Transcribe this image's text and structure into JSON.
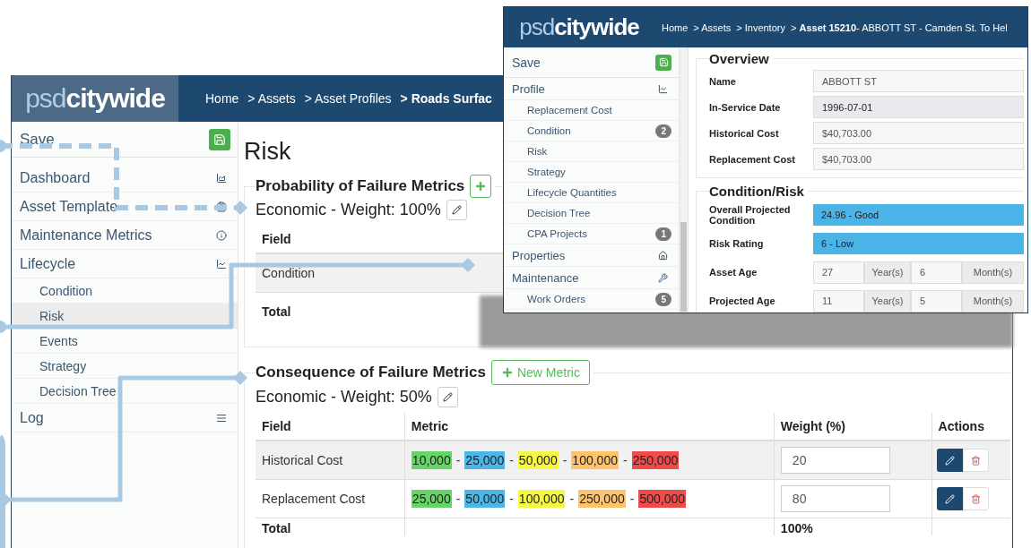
{
  "back_window": {
    "logo": {
      "light": "psd",
      "bold": "citywide"
    },
    "breadcrumb": [
      {
        "text": "Home",
        "bold": false
      },
      {
        "text": "> Assets",
        "bold": false
      },
      {
        "text": "> Asset Profiles",
        "bold": false
      },
      {
        "text": "> Roads Surfac",
        "bold": true
      }
    ],
    "sidebar": {
      "save": "Save",
      "items": [
        {
          "label": "Dashboard"
        },
        {
          "label": "Asset Template"
        },
        {
          "label": "Maintenance Metrics"
        },
        {
          "label": "Lifecycle",
          "children": [
            {
              "label": "Condition",
              "selected": false
            },
            {
              "label": "Risk",
              "selected": true
            },
            {
              "label": "Events",
              "selected": false
            },
            {
              "label": "Strategy",
              "selected": false
            },
            {
              "label": "Decision Tree",
              "selected": false
            }
          ]
        },
        {
          "label": "Log"
        }
      ]
    },
    "page_title": "Risk",
    "sections": [
      {
        "title": "Probability of Failure Metrics",
        "weight": "Economic - Weight: 100%",
        "columns": [
          "Field"
        ],
        "rows": [
          {
            "field": "Condition"
          }
        ],
        "total": {
          "label": "Total"
        }
      },
      {
        "title": "Consequence of Failure Metrics",
        "button": "New Metric",
        "weight": "Economic - Weight: 50%",
        "columns": [
          "Field",
          "Metric",
          "Weight (%)",
          "Actions"
        ],
        "rows": [
          {
            "field": "Historical Cost",
            "metric": [
              {
                "kind": "tag",
                "text": "10,000",
                "color": "#66d466"
              },
              {
                "kind": "dash",
                "text": "-"
              },
              {
                "kind": "tag",
                "text": "25,000",
                "color": "#4db6e8"
              },
              {
                "kind": "dash",
                "text": "-"
              },
              {
                "kind": "tag",
                "text": "50,000",
                "color": "#f6f742"
              },
              {
                "kind": "dash",
                "text": "-"
              },
              {
                "kind": "tag",
                "text": "100,000",
                "color": "#ffc36b"
              },
              {
                "kind": "dash",
                "text": "-"
              },
              {
                "kind": "tag",
                "text": "250,000",
                "color": "#f04a4a"
              }
            ],
            "weight": "20"
          },
          {
            "field": "Replacement Cost",
            "metric": [
              {
                "kind": "tag",
                "text": "25,000",
                "color": "#66d466"
              },
              {
                "kind": "dash",
                "text": "-"
              },
              {
                "kind": "tag",
                "text": "50,000",
                "color": "#4db6e8"
              },
              {
                "kind": "dash",
                "text": "-"
              },
              {
                "kind": "tag",
                "text": "100,000",
                "color": "#f6f742"
              },
              {
                "kind": "dash",
                "text": "-"
              },
              {
                "kind": "tag",
                "text": "250,000",
                "color": "#ffc36b"
              },
              {
                "kind": "dash",
                "text": "-"
              },
              {
                "kind": "tag",
                "text": "500,000",
                "color": "#f04a4a"
              }
            ],
            "weight": "80"
          }
        ],
        "total": {
          "label": "Total",
          "weight": "100%"
        }
      }
    ]
  },
  "front_window": {
    "logo": {
      "light": "psd",
      "bold": "citywide"
    },
    "breadcrumb": [
      {
        "text": "Home"
      },
      {
        "text": "> Assets"
      },
      {
        "text": "> Inventory"
      },
      {
        "text": "> **Asset 15210**- ABBOTT ST - Camden St. To Hel"
      }
    ],
    "sidebar": {
      "save": "Save",
      "items": [
        {
          "label": "Profile",
          "children": [
            {
              "label": "Replacement Cost"
            },
            {
              "label": "Condition",
              "badge": "2"
            },
            {
              "label": "Risk"
            },
            {
              "label": "Strategy"
            },
            {
              "label": "Lifecycle Quantities"
            },
            {
              "label": "Decision Tree"
            },
            {
              "label": "CPA Projects",
              "badge": "1"
            }
          ]
        },
        {
          "label": "Properties"
        },
        {
          "label": "Maintenance",
          "children": [
            {
              "label": "Work Orders",
              "badge": "5"
            }
          ]
        }
      ]
    },
    "overview": {
      "title": "Overview",
      "fields": [
        {
          "label": "Name",
          "value": "ABBOTT ST",
          "disabled": false
        },
        {
          "label": "In-Service Date",
          "value": "1996-07-01",
          "disabled": true
        },
        {
          "label": "Historical Cost",
          "value": "$40,703.00",
          "disabled": false
        },
        {
          "label": "Replacement Cost",
          "value": "$40,703.00",
          "disabled": false
        }
      ]
    },
    "condition_risk": {
      "title": "Condition/Risk",
      "rows": [
        {
          "kind": "bar",
          "label": "Overall Projected Condition",
          "value": "24.96 - Good"
        },
        {
          "kind": "bar",
          "label": "Risk Rating",
          "value": "6 - Low"
        },
        {
          "kind": "age",
          "label": "Asset Age",
          "years": "27",
          "years_unit": "Year(s)",
          "months": "6",
          "months_unit": "Month(s)"
        },
        {
          "kind": "age",
          "label": "Projected Age",
          "years": "11",
          "years_unit": "Year(s)",
          "months": "5",
          "months_unit": "Month(s)"
        }
      ]
    }
  }
}
